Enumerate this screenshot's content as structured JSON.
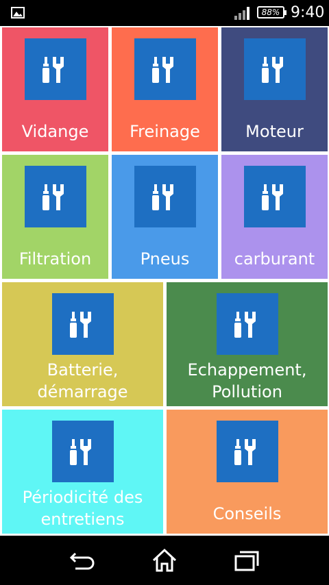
{
  "status_bar": {
    "battery_percent": "88%",
    "time": "9:40",
    "icons": [
      "image-notification-icon",
      "signal-icon",
      "battery-icon"
    ]
  },
  "tiles": [
    {
      "label": "Vidange",
      "color": "#ef5566"
    },
    {
      "label": "Freinage",
      "color": "#fe6d4e"
    },
    {
      "label": "Moteur",
      "color": "#3f4b7f"
    },
    {
      "label": "Filtration",
      "color": "#a2d467"
    },
    {
      "label": "Pneus",
      "color": "#4a9ae9"
    },
    {
      "label": "carburant",
      "color": "#ac92ed"
    },
    {
      "label": "Batterie,\ndémarrage",
      "color": "#d6c855"
    },
    {
      "label": "Echappement,\nPollution",
      "color": "#4b8b4d"
    },
    {
      "label": "Périodicité des\nentretiens",
      "color": "#5ff6f5"
    },
    {
      "label": "Conseils",
      "color": "#f99a5d"
    }
  ],
  "tile_icon": {
    "name": "tools-icon",
    "box_color": "#1e6fc2"
  },
  "nav_bar": {
    "icons": [
      "back-icon",
      "home-icon",
      "recent-apps-icon"
    ]
  }
}
